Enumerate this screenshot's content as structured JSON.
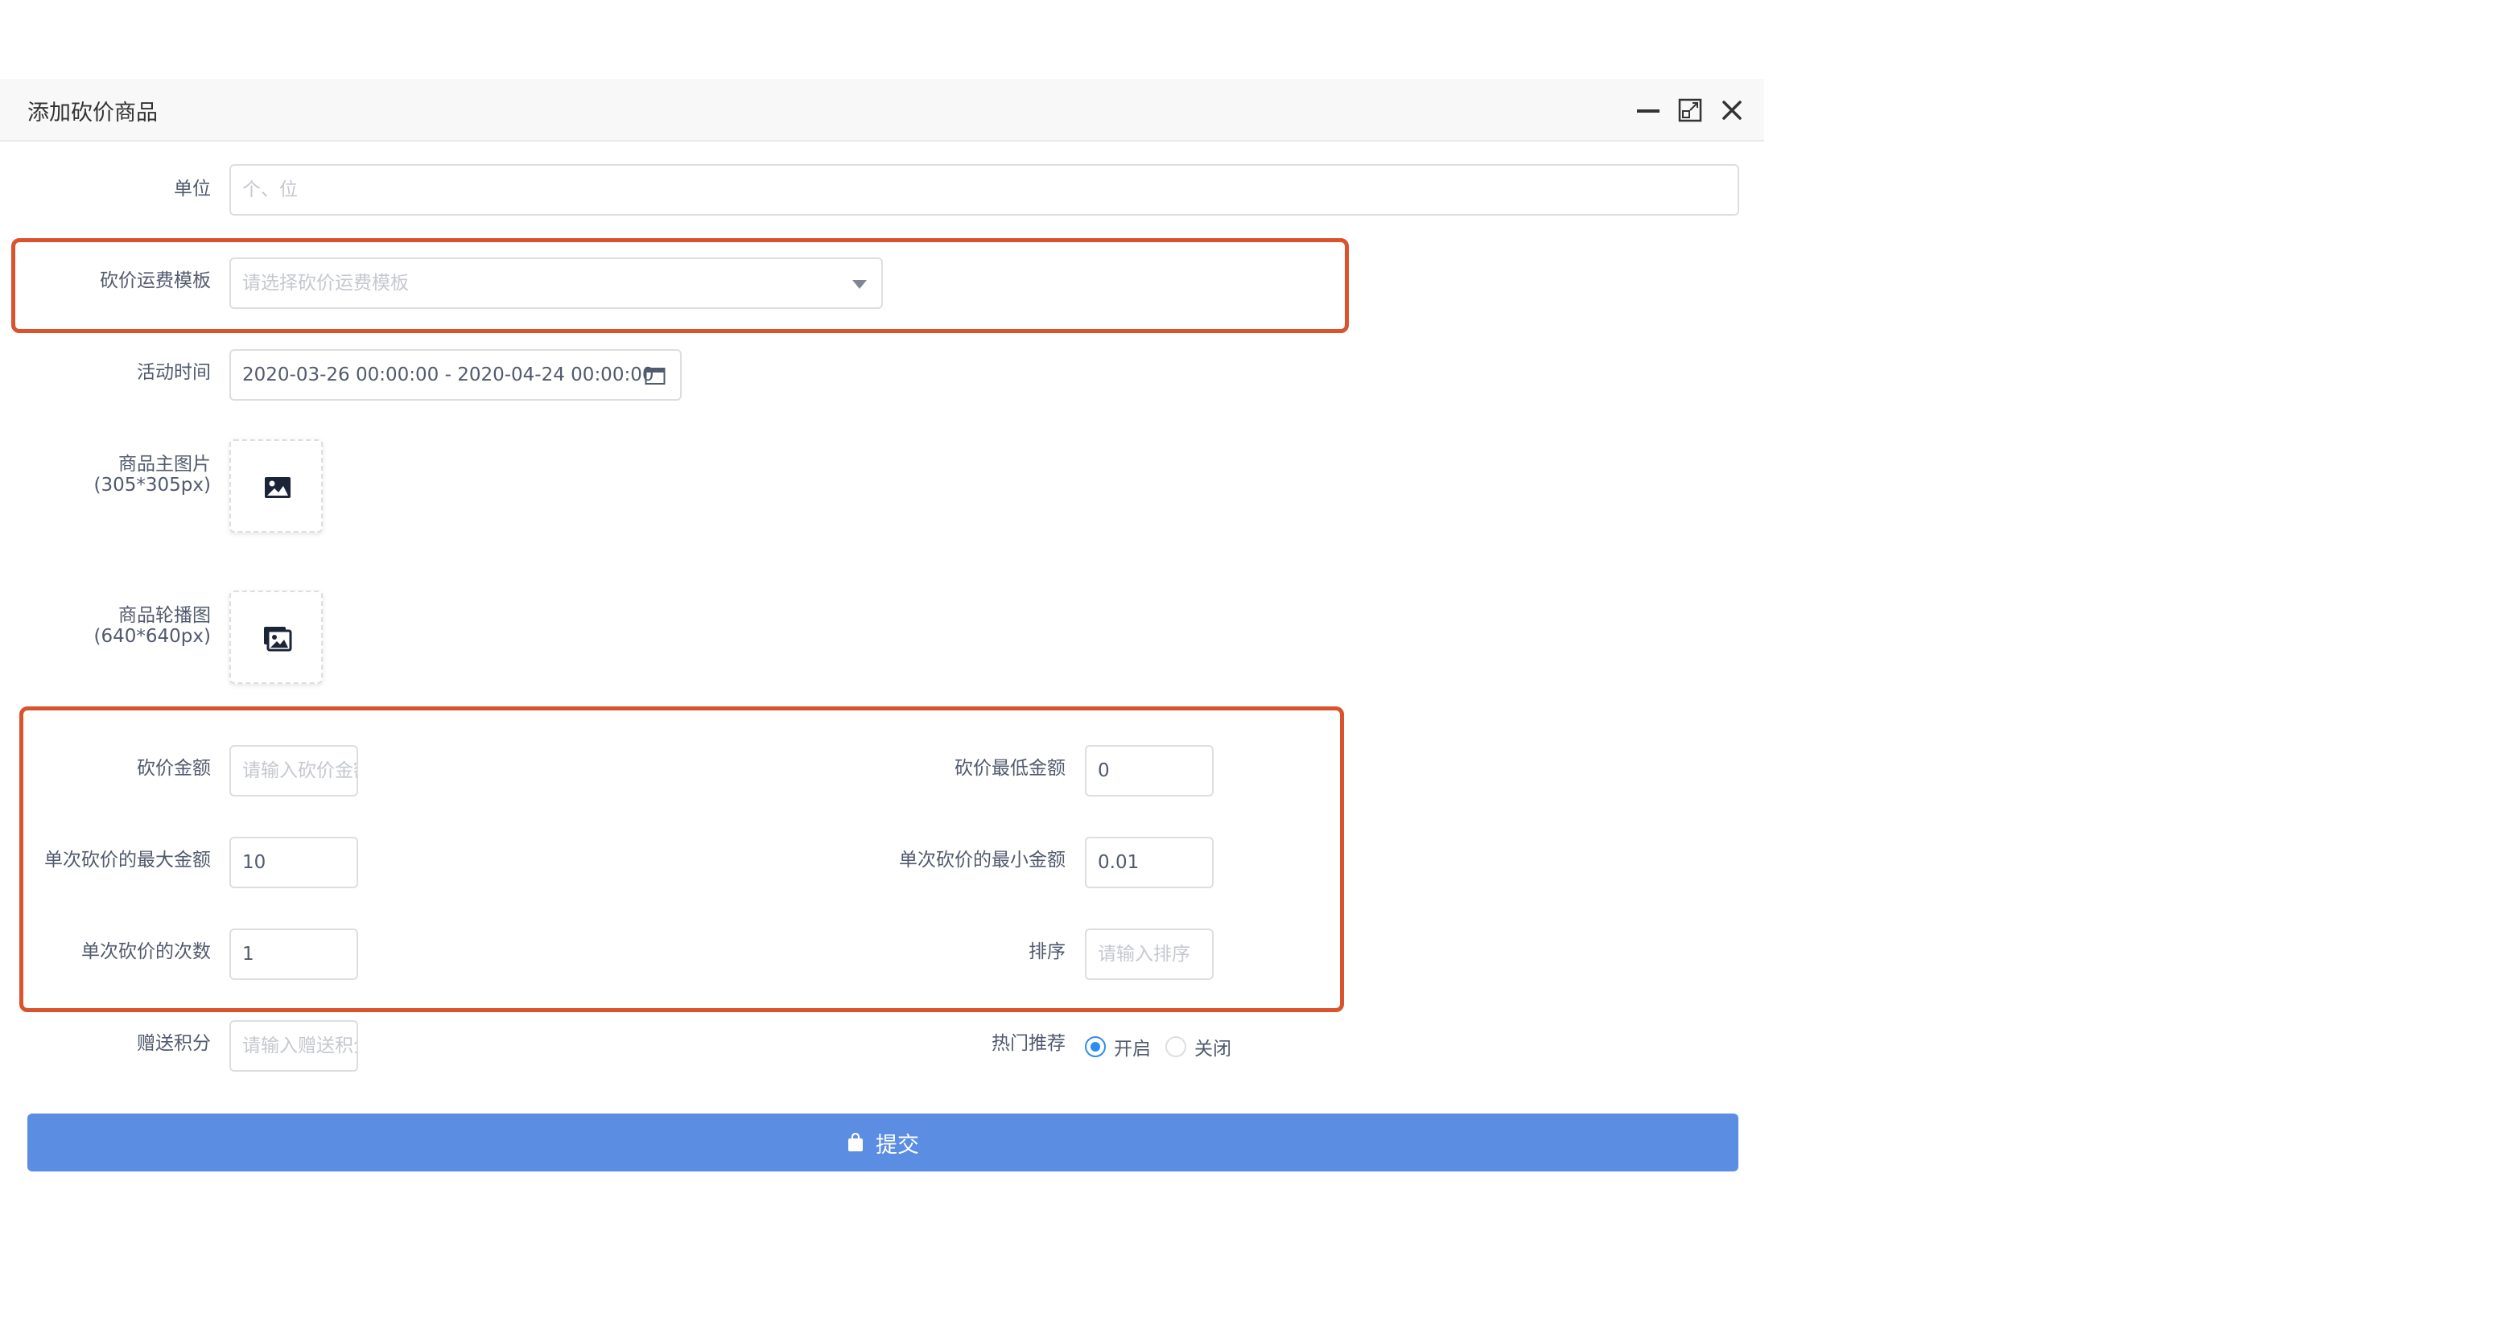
{
  "dialog": {
    "title": "添加砍价商品"
  },
  "form": {
    "unit": {
      "label": "单位",
      "placeholder": "个、位"
    },
    "freight_template": {
      "label": "砍价运费模板",
      "placeholder": "请选择砍价运费模板"
    },
    "activity_time": {
      "label": "活动时间",
      "value": "2020-03-26 00:00:00 - 2020-04-24 00:00:00"
    },
    "main_image": {
      "label_line1": "商品主图片",
      "label_line2": "(305*305px)"
    },
    "carousel_image": {
      "label_line1": "商品轮播图",
      "label_line2": "(640*640px)"
    },
    "bargain_amount": {
      "label": "砍价金额",
      "placeholder": "请输入砍价金额"
    },
    "min_bargain_amount": {
      "label": "砍价最低金额",
      "value": "0"
    },
    "single_max_amount": {
      "label": "单次砍价的最大金额",
      "value": "10"
    },
    "single_min_amount": {
      "label": "单次砍价的最小金额",
      "value": "0.01"
    },
    "single_times": {
      "label": "单次砍价的次数",
      "value": "1"
    },
    "sort": {
      "label": "排序",
      "placeholder": "请输入排序"
    },
    "gift_points": {
      "label": "赠送积分",
      "placeholder": "请输入赠送积分"
    },
    "hot_recommend": {
      "label": "热门推荐",
      "options": [
        "开启",
        "关闭"
      ],
      "selected": "开启"
    },
    "submit_label": "提交"
  },
  "colors": {
    "primary": "#5b8de3",
    "highlight": "#d9532c",
    "radio_checked": "#2d8cf0"
  }
}
